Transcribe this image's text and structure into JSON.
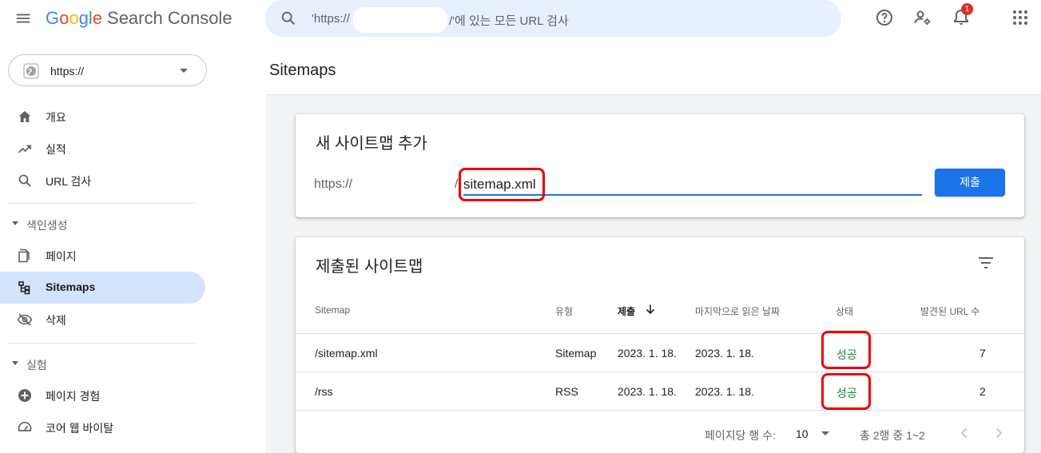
{
  "header": {
    "logo": {
      "g1": "G",
      "g2": "o",
      "g3": "o",
      "g4": "g",
      "g5": "l",
      "g6": "e",
      "product": "Search Console"
    },
    "search_placeholder_start": "'https://",
    "search_placeholder_end": "/'에 있는 모든 URL 검사",
    "notification_count": "1"
  },
  "sidebar": {
    "property": "https://",
    "items": [
      {
        "label": "개요",
        "icon": "home-icon"
      },
      {
        "label": "실적",
        "icon": "trending-up-icon"
      },
      {
        "label": "URL 검사",
        "icon": "search-icon"
      }
    ],
    "section_indexing": "색인생성",
    "indexing_items": [
      {
        "label": "페이지",
        "icon": "pages-icon"
      },
      {
        "label": "Sitemaps",
        "icon": "sitemap-icon",
        "active": true
      },
      {
        "label": "삭제",
        "icon": "visibility-off-icon"
      }
    ],
    "section_experience": "실험",
    "experience_items": [
      {
        "label": "페이지 경험",
        "icon": "add-circle-icon"
      },
      {
        "label": "코어 웹 바이탈",
        "icon": "speed-icon"
      }
    ]
  },
  "main": {
    "title": "Sitemaps",
    "add_card": {
      "title": "새 사이트맵 추가",
      "prefix": "https://",
      "slash": "/",
      "input_value": "sitemap.xml",
      "submit_label": "제출"
    },
    "list_card": {
      "title": "제출된 사이트맵",
      "columns": [
        "Sitemap",
        "유형",
        "제출",
        "마지막으로 읽은 날짜",
        "상태",
        "발견된 URL 수"
      ],
      "rows": [
        {
          "sitemap": "/sitemap.xml",
          "type": "Sitemap",
          "submitted": "2023. 1. 18.",
          "last_read": "2023. 1. 18.",
          "status": "성공",
          "urls": "7"
        },
        {
          "sitemap": "/rss",
          "type": "RSS",
          "submitted": "2023. 1. 18.",
          "last_read": "2023. 1. 18.",
          "status": "성공",
          "urls": "2"
        }
      ],
      "pager": {
        "rows_per_page_label": "페이지당 행 수:",
        "rows_per_page": "10",
        "range": "총 2행 중 1~2"
      }
    }
  },
  "colors": {
    "accent": "#1a73e8",
    "success": "#188038",
    "highlight": "#e00000",
    "active_nav": "#d2e3fc"
  }
}
